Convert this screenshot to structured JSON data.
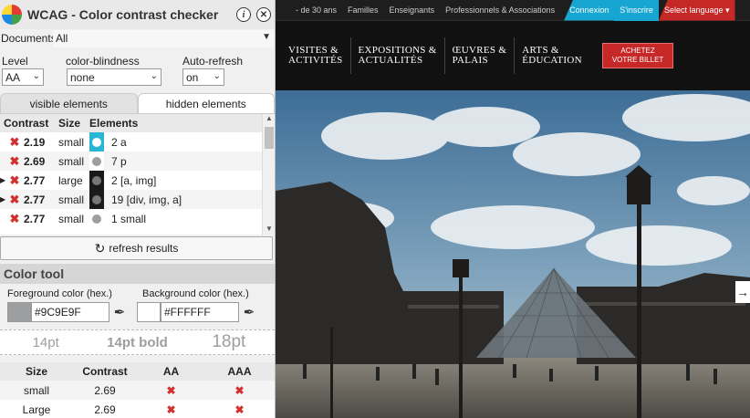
{
  "panel": {
    "title": "WCAG - Color contrast checker",
    "info_label": "i",
    "close_label": "✕",
    "documents_label": "Documents",
    "documents_value": "All",
    "level_label": "Level",
    "level_value": "AA",
    "blindness_label": "color-blindness",
    "blindness_value": "none",
    "autorefresh_label": "Auto-refresh",
    "autorefresh_value": "on",
    "tabs": [
      "visible elements",
      "hidden elements"
    ],
    "table_headers": [
      "Contrast",
      "Size",
      "Elements"
    ],
    "rows": [
      {
        "expand": "",
        "ratio": "2.19",
        "size": "small",
        "elements": "2 a",
        "swatch_bg": "#29b6d6",
        "dot": "#ffffff"
      },
      {
        "expand": "",
        "ratio": "2.69",
        "size": "small",
        "elements": "7 p",
        "swatch_bg": "#ffffff",
        "dot": "#9c9e9f"
      },
      {
        "expand": "▶",
        "ratio": "2.77",
        "size": "large",
        "elements": "2 [a, img]",
        "swatch_bg": "#1a1a1a",
        "dot": "#777777"
      },
      {
        "expand": "▶",
        "ratio": "2.77",
        "size": "small",
        "elements": "19 [div, img, a]",
        "swatch_bg": "#1a1a1a",
        "dot": "#777777"
      },
      {
        "expand": "",
        "ratio": "2.77",
        "size": "small",
        "elements": "1 small",
        "swatch_bg": "#ffffff",
        "dot": "#9c9e9f"
      }
    ],
    "refresh_label": "refresh results",
    "color_tool_title": "Color tool",
    "fg_label": "Foreground color (hex.)",
    "bg_label": "Background color (hex.)",
    "fg_value": "#9C9E9F",
    "bg_value": "#FFFFFF",
    "preview": [
      "14pt",
      "14pt bold",
      "18pt"
    ],
    "result_headers": [
      "Size",
      "Contrast",
      "AA",
      "AAA"
    ],
    "results": [
      {
        "size": "small",
        "contrast": "2.69",
        "aa": "✖",
        "aaa": "✖"
      },
      {
        "size": "Large",
        "contrast": "2.69",
        "aa": "✖",
        "aaa": "✖"
      }
    ]
  },
  "site": {
    "top_links": [
      "- de 30 ans",
      "Familles",
      "Enseignants",
      "Professionnels & Associations"
    ],
    "connexion": "Connexion",
    "inscrire": "S'inscrire",
    "language": "Select language ▾",
    "nav": [
      {
        "line1": "Visites &",
        "line2": "activités"
      },
      {
        "line1": "Expositions &",
        "line2": "actualités"
      },
      {
        "line1": "Œuvres &",
        "line2": "palais"
      },
      {
        "line1": "Arts &",
        "line2": "éducation"
      }
    ],
    "buy_line1": "ACHETEZ",
    "buy_line2": "VOTRE BILLET",
    "next_arrow": "→"
  }
}
